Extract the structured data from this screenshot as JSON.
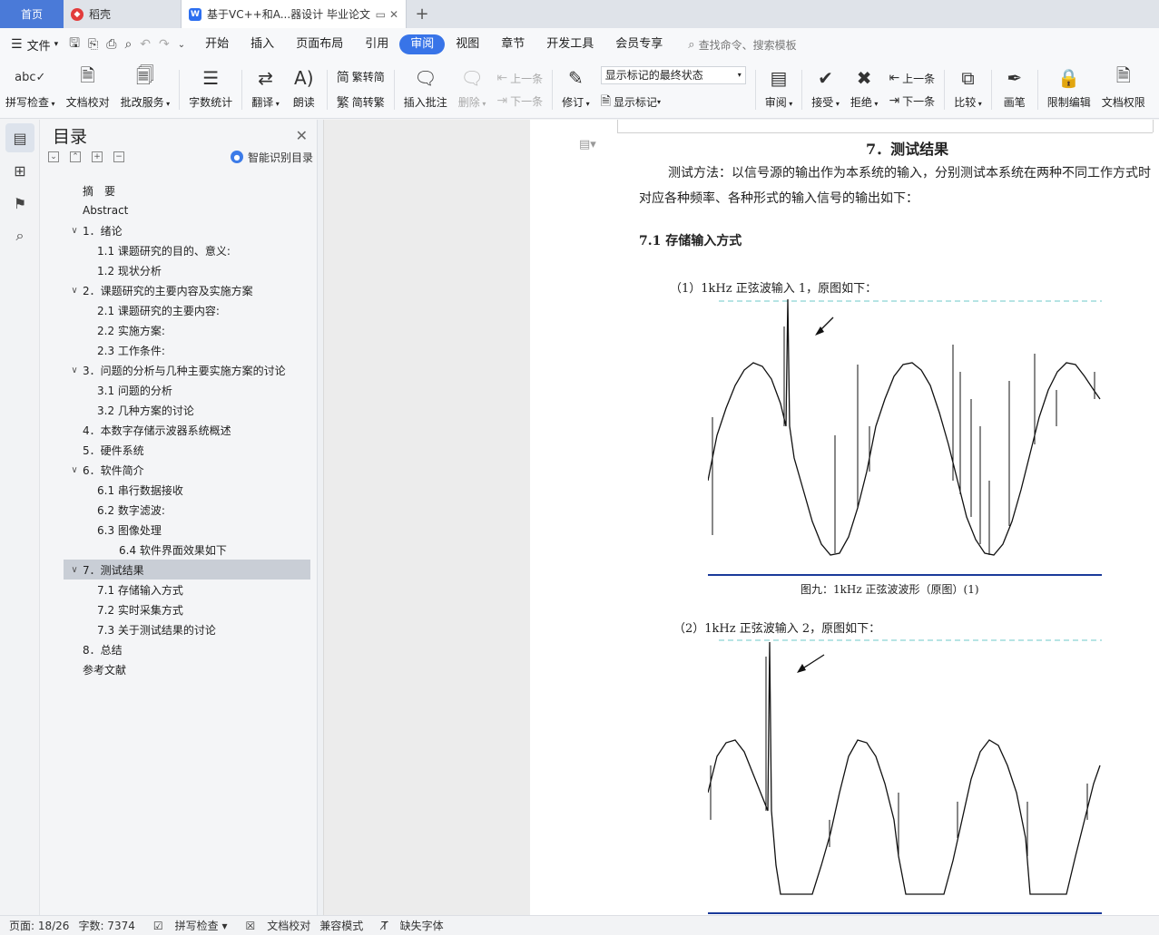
{
  "tabs": {
    "home": "首页",
    "docer": "稻壳",
    "doc_title": "基于VC++和A...器设计 毕业论文",
    "docer_icon": "docer-logo-icon",
    "doc_icon": "wps-writer-icon"
  },
  "menu": {
    "file": "文件",
    "items": [
      "开始",
      "插入",
      "页面布局",
      "引用",
      "审阅",
      "视图",
      "章节",
      "开发工具",
      "会员专享"
    ],
    "active_item": "审阅",
    "search_placeholder": "查找命令、搜索模板"
  },
  "ribbon": {
    "spell_check": "拼写检查",
    "doc_proof": "文档校对",
    "revise_service": "批改服务",
    "word_count": "字数统计",
    "translate": "翻译",
    "read_aloud": "朗读",
    "trad_to_simp": "繁转简",
    "simp_to_trad": "简转繁",
    "insert_comment": "插入批注",
    "delete": "删除",
    "prev_comment": "上一条",
    "next_comment": "下一条",
    "track_changes": "修订",
    "markup_state": "显示标记的最终状态",
    "show_markup": "显示标记",
    "review_pane": "审阅",
    "accept": "接受",
    "reject": "拒绝",
    "prev_change": "上一条",
    "next_change": "下一条",
    "compare": "比较",
    "pen": "画笔",
    "restrict_edit": "限制编辑",
    "doc_permission": "文档权限"
  },
  "toc": {
    "title": "目录",
    "smart_btn": "智能识别目录",
    "items": [
      {
        "text": "摘　要",
        "level": 1,
        "chevron": false
      },
      {
        "text": "Abstract",
        "level": 1,
        "chevron": false
      },
      {
        "text": "1．绪论",
        "level": 1,
        "chevron": true
      },
      {
        "text": "1.1 课题研究的目的、意义:",
        "level": 2,
        "chevron": false
      },
      {
        "text": "1.2 现状分析",
        "level": 2,
        "chevron": false
      },
      {
        "text": "2．课题研究的主要内容及实施方案",
        "level": 1,
        "chevron": true
      },
      {
        "text": "2.1 课题研究的主要内容:",
        "level": 2,
        "chevron": false
      },
      {
        "text": "2.2 实施方案:",
        "level": 2,
        "chevron": false
      },
      {
        "text": "2.3 工作条件:",
        "level": 2,
        "chevron": false
      },
      {
        "text": "3．问题的分析与几种主要实施方案的讨论",
        "level": 1,
        "chevron": true
      },
      {
        "text": "3.1 问题的分析",
        "level": 2,
        "chevron": false
      },
      {
        "text": "3.2 几种方案的讨论",
        "level": 2,
        "chevron": false
      },
      {
        "text": "4．本数字存储示波器系统概述",
        "level": 1,
        "chevron": false
      },
      {
        "text": "5．硬件系统",
        "level": 1,
        "chevron": false
      },
      {
        "text": "6．软件简介",
        "level": 1,
        "chevron": true
      },
      {
        "text": "6.1 串行数据接收",
        "level": 2,
        "chevron": false
      },
      {
        "text": "6.2 数字滤波:",
        "level": 2,
        "chevron": false
      },
      {
        "text": "6.3 图像处理",
        "level": 2,
        "chevron": false
      },
      {
        "text": "6.4 软件界面效果如下",
        "level": 3,
        "chevron": false
      },
      {
        "text": "7．测试结果",
        "level": 1,
        "chevron": true,
        "selected": true
      },
      {
        "text": "7.1 存储输入方式",
        "level": 2,
        "chevron": false
      },
      {
        "text": "7.2 实时采集方式",
        "level": 2,
        "chevron": false
      },
      {
        "text": "7.3 关于测试结果的讨论",
        "level": 2,
        "chevron": false
      },
      {
        "text": "8．总结",
        "level": 1,
        "chevron": false
      },
      {
        "text": "参考文献",
        "level": 1,
        "chevron": false
      }
    ]
  },
  "doc": {
    "heading": "7．测试结果",
    "paragraph": "测试方法：以信号源的输出作为本系统的输入，分别测试本系统在两种不同工作方式时对应各种频率、各种形式的输入信号的输出如下：",
    "subheading": "7.1 存储输入方式",
    "fig1_title": "（1）1kHz 正弦波输入 1，原图如下：",
    "fig1_caption": "图九：1kHz 正弦波波形（原图）(1)",
    "fig2_title": "（2）1kHz 正弦波输入 2，原图如下："
  },
  "status": {
    "page": "页面: 18/26",
    "words": "字数: 7374",
    "spell": "拼写检查",
    "proof": "文档校对",
    "compat": "兼容模式",
    "missing_font": "缺失字体"
  }
}
